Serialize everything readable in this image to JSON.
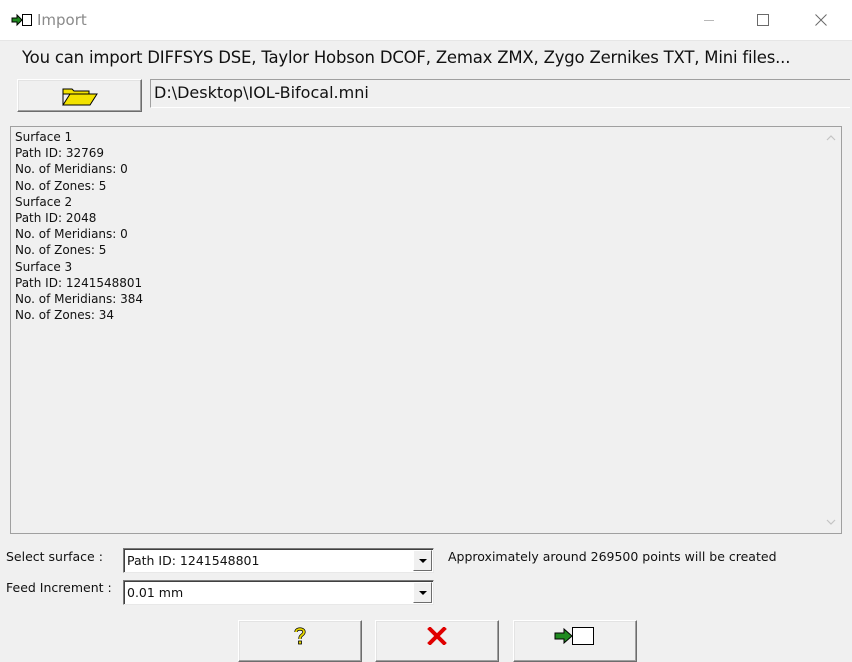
{
  "window": {
    "title": "Import",
    "icon": "import-arrow-icon"
  },
  "info_text": "You can import DIFFSYS DSE, Taylor Hobson DCOF, Zemax ZMX, Zygo Zernikes TXT, Mini files...",
  "file": {
    "browse_icon": "folder-open-icon",
    "path": "D:\\Desktop\\IOL-Bifocal.mni"
  },
  "surface_info": {
    "lines": [
      "Surface 1",
      "Path ID: 32769",
      "No. of Meridians: 0",
      "No. of Zones: 5",
      "Surface 2",
      "Path ID: 2048",
      "No. of Meridians: 0",
      "No. of Zones: 5",
      "Surface 3",
      "Path ID: 1241548801",
      "No. of Meridians: 384",
      "No. of Zones: 34"
    ]
  },
  "select_surface": {
    "label": "Select surface :",
    "value": "Path ID: 1241548801"
  },
  "feed_increment": {
    "label": "Feed Increment :",
    "value": "0.01 mm"
  },
  "points_note": "Approximately around 269500 points will be created",
  "buttons": {
    "help_icon": "question-mark-icon",
    "cancel_icon": "red-x-icon",
    "ok_icon": "import-arrow-icon"
  },
  "colors": {
    "help": "#d4c400",
    "cancel": "#e00000",
    "ok_arrow": "#1f8a1f"
  }
}
